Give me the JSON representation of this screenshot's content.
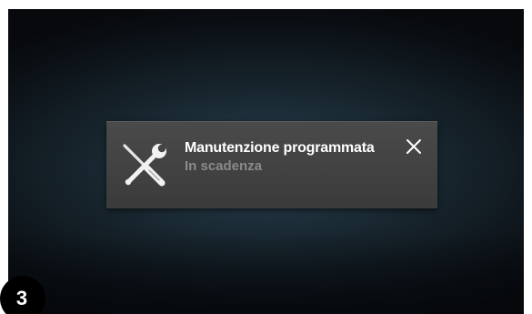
{
  "notification": {
    "icon": "wrench-screwdriver-icon",
    "title": "Manutenzione programmata",
    "subtitle": "In scadenza",
    "close_icon": "close-icon"
  },
  "step_badge": "3",
  "colors": {
    "screen_bg": "#0b1015",
    "panel_bg": "#444444",
    "title_text": "#ffffff",
    "subtitle_text": "#8a8a8a"
  }
}
